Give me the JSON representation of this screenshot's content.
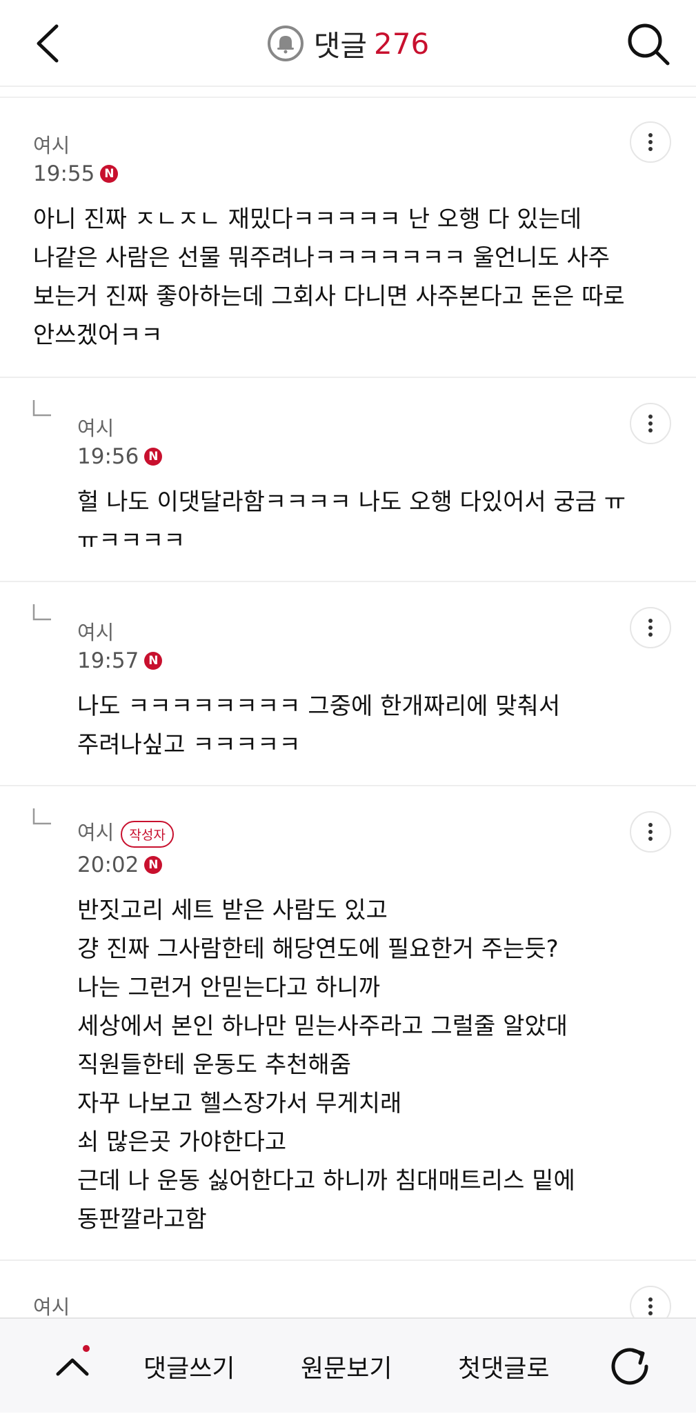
{
  "header": {
    "title": "댓글",
    "count": "276"
  },
  "comments": [
    {
      "author": "여시",
      "time": "19:55",
      "badge": "N",
      "text": "아니 진짜 ㅈㄴㅈㄴ 재밌다ㅋㅋㅋㅋㅋ 난 오행 다 있는데\n나같은 사람은 선물 뭐주려나ㅋㅋㅋㅋㅋㅋㅋ 울언니도 사주\n보는거 진짜 좋아하는데 그회사 다니면 사주본다고 돈은 따로\n안쓰겠어ㅋㅋ"
    },
    {
      "author": "여시",
      "time": "19:56",
      "badge": "N",
      "text": "헐 나도 이댓달라함ㅋㅋㅋㅋ 나도 오행 다있어서 궁금 ㅠ\nㅠㅋㅋㅋㅋ"
    },
    {
      "author": "여시",
      "time": "19:57",
      "badge": "N",
      "text": "나도 ㅋㅋㅋㅋㅋㅋㅋㅋ 그중에 한개짜리에 맞춰서\n주려나싶고 ㅋㅋㅋㅋㅋ"
    },
    {
      "author": "여시",
      "author_tag": "작성자",
      "time": "20:02",
      "badge": "N",
      "text": "반짓고리 세트 받은 사람도 있고\n걍 진짜 그사람한테 해당연도에 필요한거 주는듯?\n나는 그런거 안믿는다고 하니까\n세상에서 본인 하나만 믿는사주라고 그럴줄 알았대\n직원들한테 운동도 추천해줌\n자꾸 나보고 헬스장가서 무게치래\n쇠 많은곳 가야한다고\n근데 나 운동 싫어한다고 하니까 침대매트리스 밑에\n동판깔라고함"
    },
    {
      "author": "여시"
    }
  ],
  "bottom_bar": {
    "write_comment": "댓글쓰기",
    "view_original": "원문보기",
    "first_comment": "첫댓글로"
  },
  "colors": {
    "accent": "#c8102e",
    "divider": "#eeeeee"
  },
  "icons": [
    "back-arrow-icon",
    "bell-icon",
    "search-icon",
    "more-vertical-icon",
    "reply-arrow-icon",
    "chevron-up-icon",
    "refresh-icon"
  ]
}
